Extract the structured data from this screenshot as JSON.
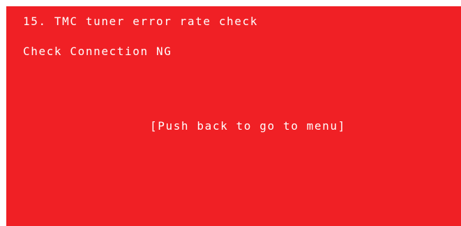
{
  "screen": {
    "background_color": "#f02025",
    "text_color": "#ffffff",
    "title": "15. TMC tuner error rate check",
    "status": "Check Connection NG",
    "hint": "[Push back to go to menu]"
  }
}
